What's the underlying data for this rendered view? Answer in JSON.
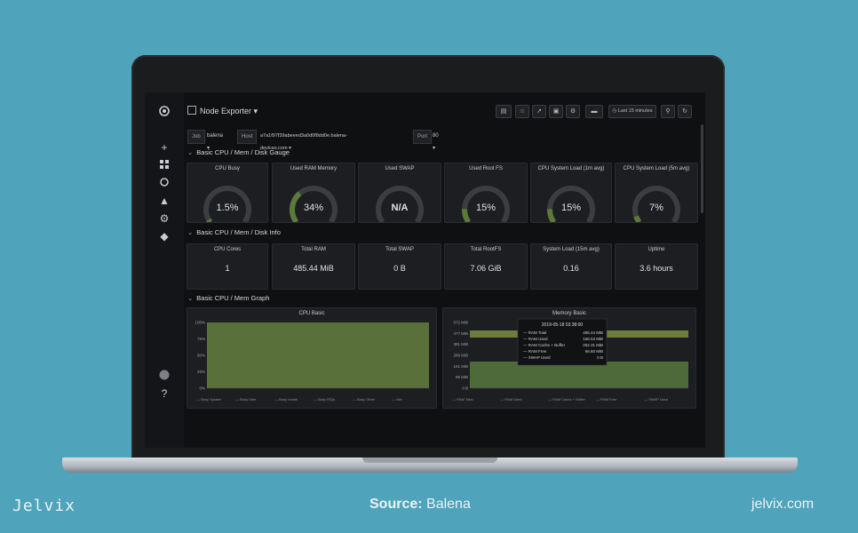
{
  "brand": {
    "left": "Jelvix",
    "source_prefix": "Source:",
    "source": "Balena",
    "right": "jelvix.com"
  },
  "dashboard": {
    "title": "Node Exporter",
    "toolbar": {
      "time_range": "Last 15 minutes"
    },
    "variables": [
      {
        "label": "Job",
        "value": "balena"
      },
      {
        "label": "Host",
        "value": "a7a1f97f39abeeed3a0d0f8dd0e.balena-devices.com"
      },
      {
        "label": "Port",
        "value": "80"
      }
    ],
    "sections": [
      "Basic CPU / Mem / Disk Gauge",
      "Basic CPU / Mem / Disk Info",
      "Basic CPU / Mem Graph"
    ],
    "gauges": [
      {
        "title": "CPU Busy",
        "value": "1.5%",
        "fraction": 0.015
      },
      {
        "title": "Used RAM Memory",
        "value": "34%",
        "fraction": 0.34
      },
      {
        "title": "Used SWAP",
        "value": "N/A",
        "fraction": 0
      },
      {
        "title": "Used Root FS",
        "value": "15%",
        "fraction": 0.15
      },
      {
        "title": "CPU System Load (1m avg)",
        "value": "15%",
        "fraction": 0.15
      },
      {
        "title": "CPU System Load (5m avg)",
        "value": "7%",
        "fraction": 0.07
      }
    ],
    "stats": [
      {
        "title": "CPU Cores",
        "value": "1"
      },
      {
        "title": "Total RAM",
        "value": "485.44 MiB"
      },
      {
        "title": "Total SWAP",
        "value": "0 B"
      },
      {
        "title": "Total RootFS",
        "value": "7.06 GiB"
      },
      {
        "title": "System Load (15m avg)",
        "value": "0.16"
      },
      {
        "title": "Uptime",
        "value": "3.6 hours"
      }
    ],
    "cpu_graph": {
      "title": "CPU Basic",
      "y_ticks": [
        "100%",
        "75%",
        "50%",
        "25%",
        "0%"
      ],
      "legend": [
        "Busy System",
        "Busy User",
        "Busy Iowait",
        "Busy IRQs",
        "Busy Other",
        "Idle"
      ]
    },
    "memory_graph": {
      "title": "Memory Basic",
      "y_ticks": [
        "572 MiB",
        "477 MiB",
        "381 MiB",
        "286 MiB",
        "191 MiB",
        "95 MiB",
        "0 B"
      ],
      "legend": [
        "RAM Total",
        "RAM Used",
        "RAM Cache + Buffer",
        "RAM Free",
        "SWAP Used"
      ],
      "tooltip": {
        "time": "2019-05-18 03:38:00",
        "rows": [
          {
            "label": "RAM Total",
            "value": "485.44 MiB"
          },
          {
            "label": "RAM Used",
            "value": "166.53 MiB"
          },
          {
            "label": "RAM Cache + Buffer",
            "value": "252.31 MiB"
          },
          {
            "label": "RAM Free",
            "value": "66.60 MiB"
          },
          {
            "label": "SWAP Used",
            "value": "0 B"
          }
        ]
      }
    }
  },
  "colors": {
    "background": "#4fa3ba",
    "panel": "#1d1e21",
    "gauge_green": "#5b7a3a",
    "graph_fill": "#59703a"
  }
}
